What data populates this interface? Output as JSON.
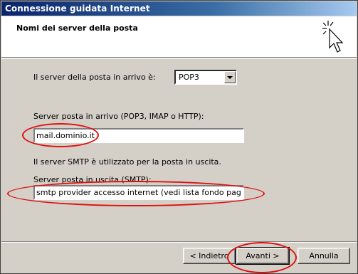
{
  "window": {
    "title": "Connessione guidata Internet"
  },
  "header": {
    "subtitle": "Nomi dei server della posta"
  },
  "form": {
    "incoming_type_label": "Il server della posta in arrivo è:",
    "incoming_type_value": "POP3",
    "incoming_server_label": "Server posta in arrivo (POP3, IMAP o HTTP):",
    "incoming_server_value": "mail.dominio.it",
    "smtp_info": "Il server SMTP è utilizzato per la posta in uscita.",
    "outgoing_server_label": "Server posta in uscita (SMTP):",
    "outgoing_server_value": "smtp provider accesso internet (vedi lista fondo pagina*)"
  },
  "buttons": {
    "back": "< Indietro",
    "next": "Avanti >",
    "cancel": "Annulla"
  },
  "colors": {
    "annotation": "#e01010",
    "titlebar": "#0a246a"
  },
  "icons": {
    "wizard": "cursor-sparkle-icon"
  }
}
